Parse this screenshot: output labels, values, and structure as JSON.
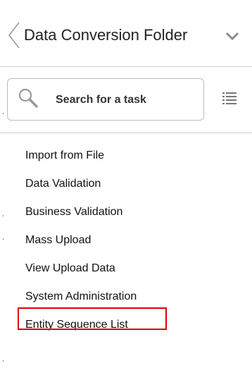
{
  "header": {
    "title": "Data Conversion Folder",
    "back_icon": "chevron-left-icon",
    "menu_icon": "chevron-down-icon"
  },
  "search": {
    "placeholder": "Search for a task",
    "icon": "search-icon",
    "list_toggle_icon": "list-icon"
  },
  "tasks": {
    "items": [
      {
        "label": "Import from File"
      },
      {
        "label": "Data Validation"
      },
      {
        "label": "Business Validation"
      },
      {
        "label": "Mass Upload"
      },
      {
        "label": "View Upload Data"
      },
      {
        "label": "System Administration"
      },
      {
        "label": "Entity Sequence List"
      }
    ],
    "highlighted": "Entity Sequence List"
  },
  "colors": {
    "highlight_border": "#e00000",
    "divider": "#cfcfcf",
    "icon": "#9a9a9a"
  }
}
